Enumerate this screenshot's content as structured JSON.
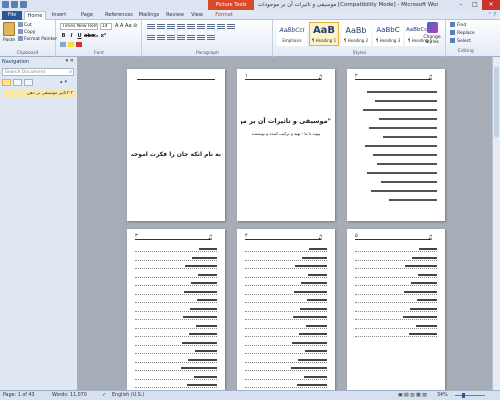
{
  "window": {
    "context_tab": "Picture Tools",
    "title": "موسیقی و تاثیرات آن بر موجودات [Compatibility Mode] - Microsoft Word"
  },
  "tabs": [
    {
      "label": "File",
      "state": "file"
    },
    {
      "label": "Home",
      "state": "active"
    },
    {
      "label": "Insert",
      "state": ""
    },
    {
      "label": "Page Layout",
      "state": ""
    },
    {
      "label": "References",
      "state": ""
    },
    {
      "label": "Mailings",
      "state": ""
    },
    {
      "label": "Review",
      "state": ""
    },
    {
      "label": "View",
      "state": ""
    },
    {
      "label": "Format",
      "state": "format"
    }
  ],
  "clipboard": {
    "paste": "Paste",
    "cut": "Cut",
    "copy": "Copy",
    "format_painter": "Format Painter",
    "label": "Clipboard"
  },
  "font": {
    "name": "Times New Rom",
    "size": "14",
    "label": "Font"
  },
  "paragraph": {
    "label": "Paragraph"
  },
  "styles": {
    "label": "Styles",
    "items": [
      {
        "sample": "AaBbCcI",
        "name": "Emphasis",
        "selected": false
      },
      {
        "sample": "AaB",
        "name": "¶ Heading 1",
        "selected": true
      },
      {
        "sample": "AaBb",
        "name": "¶ Heading 2",
        "selected": false
      },
      {
        "sample": "AaBbC",
        "name": "¶ Heading 3",
        "selected": false
      },
      {
        "sample": "AaBbCcDd",
        "name": "¶ Heading 5",
        "selected": false
      }
    ],
    "change_styles": "Change Styles"
  },
  "editing": {
    "find": "Find",
    "replace": "Replace",
    "select": "Select",
    "label": "Editing"
  },
  "navigation": {
    "title": "Navigation",
    "search_placeholder": "Search Document",
    "item": "۳-۳تاثیر موسیقی بر ذهن"
  },
  "pages": {
    "page1_text": "به نام آنکه جان را فکرت آموخت",
    "page2_title": "\"موسیقی و تاثیرات آن بر موجودات\"",
    "page2_subtitle": "پیوند با ما - تهیه و ترکیب کننده و نویسنده"
  },
  "status": {
    "page": "Page: 1 of 43",
    "words": "Words: 11,070",
    "language": "English (U.S.)",
    "zoom": "34%"
  }
}
